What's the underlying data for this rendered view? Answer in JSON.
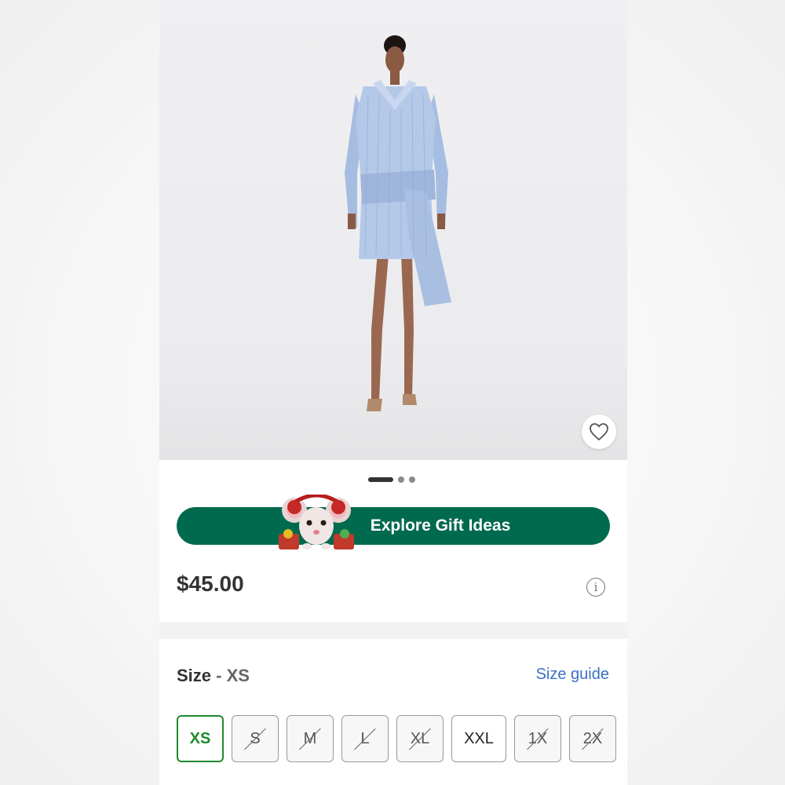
{
  "product": {
    "image_dots": {
      "count": 3,
      "active": 0
    },
    "favorite_icon": "heart-outline-icon"
  },
  "promo": {
    "gift_button_label": "Explore Gift Ideas",
    "mascot": "mouse-with-earmuffs-icon"
  },
  "pricing": {
    "price": "$45.00",
    "info_icon": "info-icon",
    "info_glyph": "i"
  },
  "size": {
    "label": "Size",
    "separator": " - ",
    "selected": "XS",
    "guide_label": "Size guide",
    "options": [
      {
        "label": "XS",
        "available": true,
        "selected": true
      },
      {
        "label": "S",
        "available": false,
        "selected": false
      },
      {
        "label": "M",
        "available": false,
        "selected": false
      },
      {
        "label": "L",
        "available": false,
        "selected": false
      },
      {
        "label": "XL",
        "available": false,
        "selected": false
      },
      {
        "label": "XXL",
        "available": true,
        "selected": false
      },
      {
        "label": "1X",
        "available": false,
        "selected": false
      },
      {
        "label": "2X",
        "available": false,
        "selected": false
      }
    ]
  },
  "colors": {
    "gift_button": "#006a4e",
    "selected_size": "#1f8a2c",
    "link": "#3a6fc4"
  }
}
